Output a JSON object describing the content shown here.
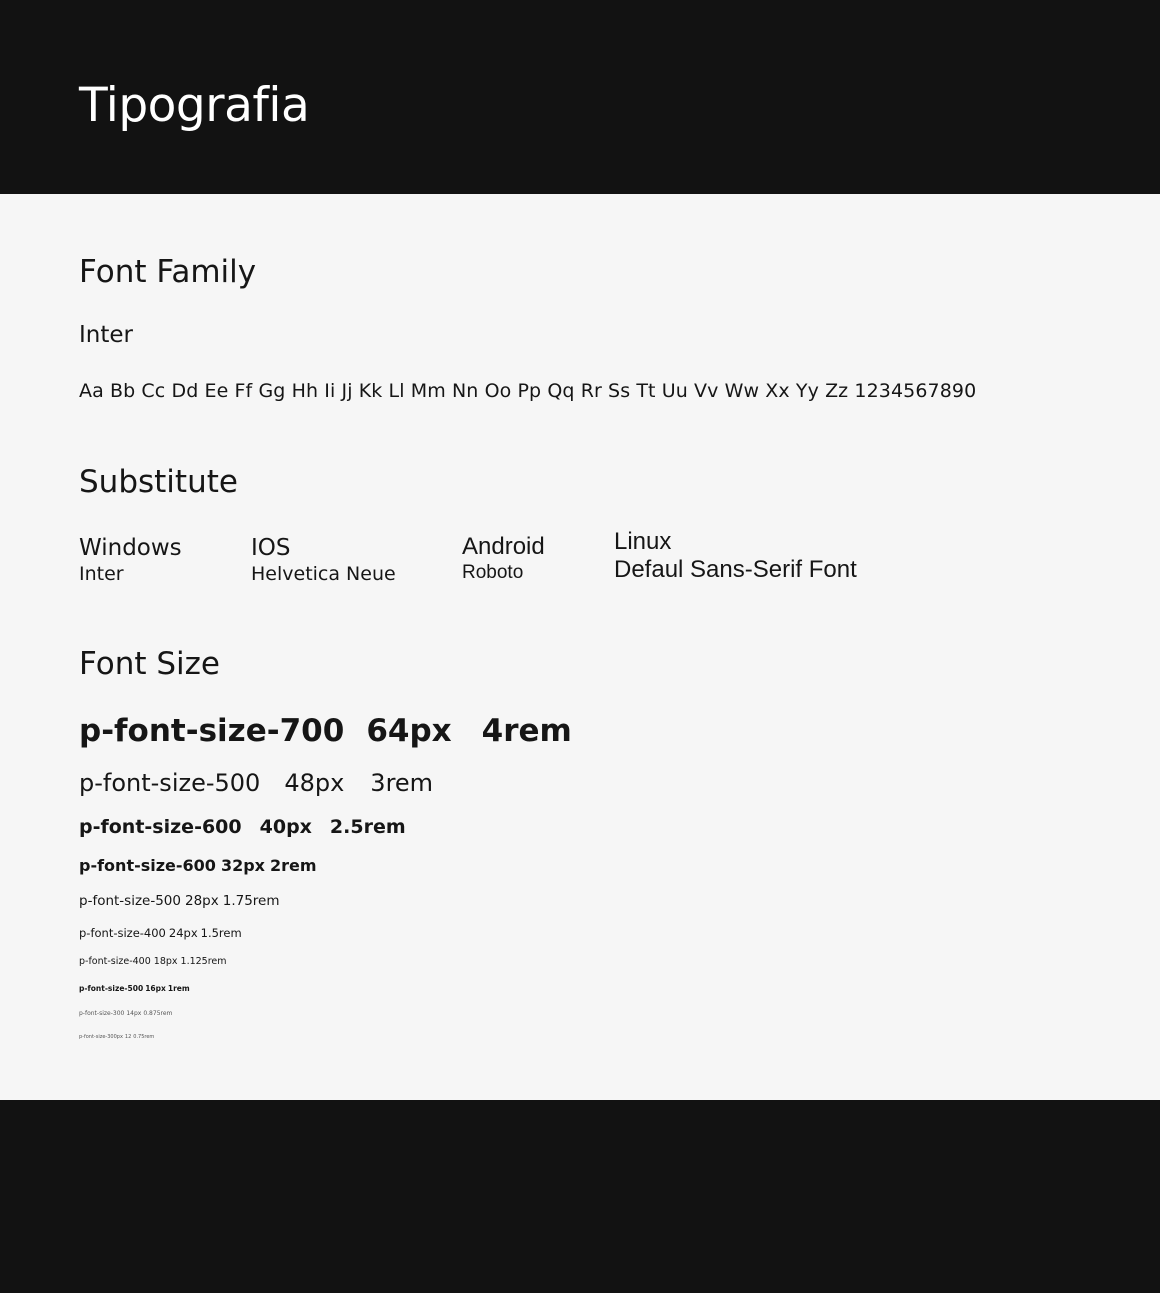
{
  "header": {
    "title": "Tipografia"
  },
  "font_family": {
    "heading": "Font Family",
    "name": "Inter",
    "alphabet": "Aa Bb Cc Dd Ee Ff Gg Hh Ii Jj Kk Ll Mm Nn Oo Pp Qq Rr Ss Tt Uu Vv Ww Xx Yy Zz 1234567890"
  },
  "substitute": {
    "heading": "Substitute",
    "items": [
      {
        "os": "Windows",
        "font": "Inter"
      },
      {
        "os": "IOS",
        "font": "Helvetica Neue"
      },
      {
        "os": "Android",
        "font": "Roboto"
      },
      {
        "os": "Linux",
        "font": "Defaul Sans-Serif Font"
      }
    ]
  },
  "font_size": {
    "heading": "Font Size",
    "rows": [
      {
        "token": "p-font-size-700",
        "px": "64px",
        "rem": "4rem"
      },
      {
        "token": "p-font-size-500",
        "px": "48px",
        "rem": "3rem"
      },
      {
        "token": "p-font-size-600",
        "px": "40px",
        "rem": "2.5rem"
      },
      {
        "token": "p-font-size-600",
        "px": "32px",
        "rem": "2rem"
      },
      {
        "token": "p-font-size-500",
        "px": "28px",
        "rem": "1.75rem"
      },
      {
        "token": "p-font-size-400",
        "px": "24px",
        "rem": "1.5rem"
      },
      {
        "token": "p-font-size-400",
        "px": "18px",
        "rem": "1.125rem"
      },
      {
        "token": "p-font-size-500",
        "px": "16px",
        "rem": "1rem"
      },
      {
        "token": "p-font-size-300",
        "px": "14px",
        "rem": "0.875rem"
      },
      {
        "token": "p-font-size-300px",
        "px": "12",
        "rem": "0.75rem"
      }
    ]
  }
}
